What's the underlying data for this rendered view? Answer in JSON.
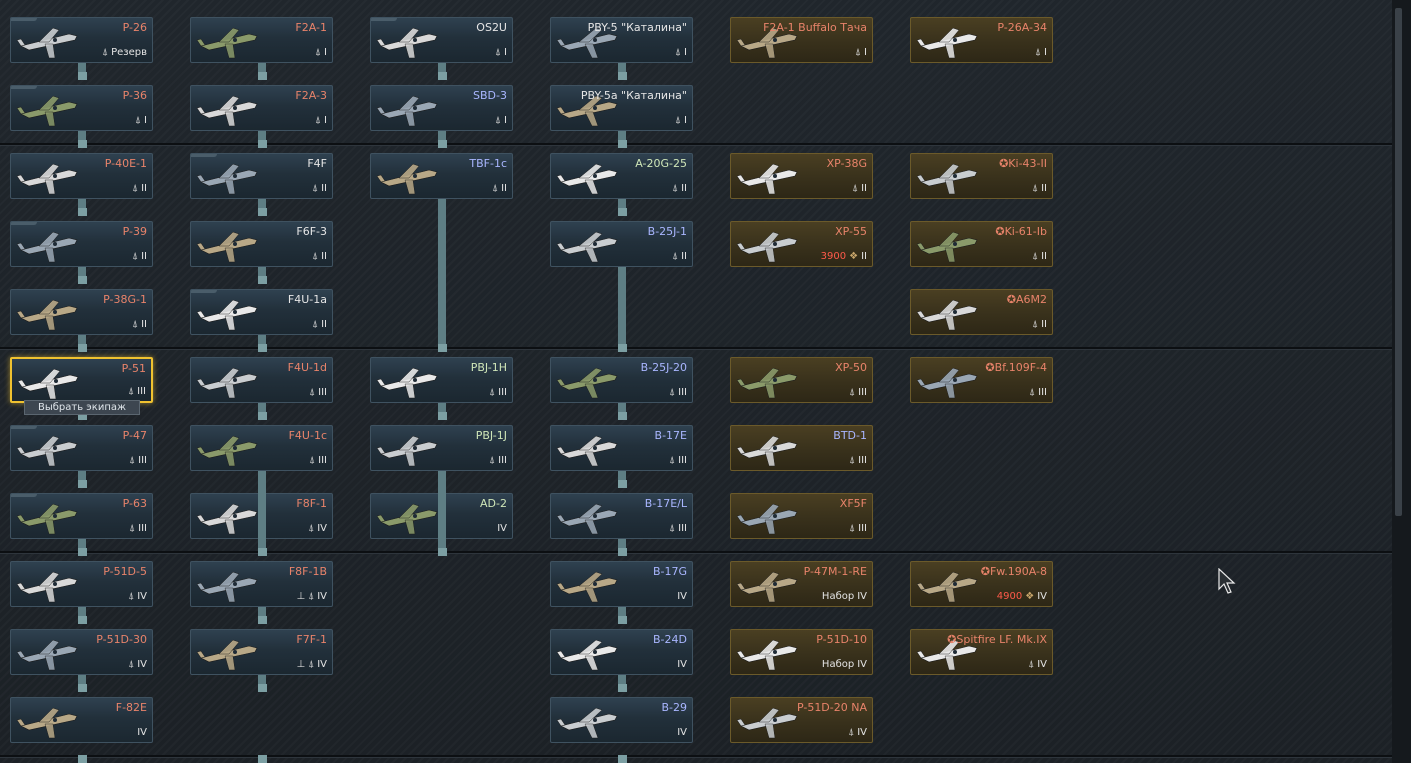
{
  "columns": [
    [
      {
        "name": "P-26",
        "sub": "Резерв",
        "rank": "",
        "color": "red",
        "tab": true
      },
      {
        "name": "P-36",
        "sub": "",
        "rank": "I",
        "color": "red",
        "tab": true
      },
      {
        "name": "P-40E-1",
        "sub": "",
        "rank": "II",
        "color": "red",
        "tab": false
      },
      {
        "name": "P-39",
        "sub": "",
        "rank": "II",
        "color": "red",
        "tab": true
      },
      {
        "name": "P-38G-1",
        "sub": "",
        "rank": "II",
        "color": "red",
        "tab": false
      },
      {
        "name": "P-51",
        "sub": "",
        "rank": "III",
        "color": "red",
        "tab": false,
        "selected": true
      },
      {
        "name": "P-47",
        "sub": "",
        "rank": "III",
        "color": "red",
        "tab": true
      },
      {
        "name": "P-63",
        "sub": "",
        "rank": "III",
        "color": "red",
        "tab": true
      },
      {
        "name": "P-51D-5",
        "sub": "",
        "rank": "IV",
        "color": "red",
        "tab": false
      },
      {
        "name": "P-51D-30",
        "sub": "",
        "rank": "IV",
        "color": "red",
        "tab": false
      },
      {
        "name": "F-82E",
        "sub": "",
        "rank": "IV",
        "color": "red",
        "tab": false,
        "nospade": true
      }
    ],
    [
      {
        "name": "F2A-1",
        "sub": "",
        "rank": "I",
        "color": "red",
        "tab": false
      },
      {
        "name": "F2A-3",
        "sub": "",
        "rank": "I",
        "color": "red",
        "tab": false
      },
      {
        "name": "F4F",
        "sub": "",
        "rank": "II",
        "color": "light",
        "tab": true
      },
      {
        "name": "F6F-3",
        "sub": "",
        "rank": "II",
        "color": "light",
        "tab": false
      },
      {
        "name": "F4U-1a",
        "sub": "",
        "rank": "II",
        "color": "light",
        "tab": true
      },
      {
        "name": "F4U-1d",
        "sub": "",
        "rank": "III",
        "color": "red",
        "tab": false
      },
      {
        "name": "F4U-1c",
        "sub": "",
        "rank": "III",
        "color": "red",
        "tab": false
      },
      {
        "name": "F8F-1",
        "sub": "",
        "rank": "IV",
        "color": "red",
        "tab": false
      },
      {
        "name": "F8F-1B",
        "sub": "",
        "rank": "IV",
        "color": "red",
        "tab": false,
        "bomb": true
      },
      {
        "name": "F7F-1",
        "sub": "",
        "rank": "IV",
        "color": "red",
        "tab": false,
        "bomb": true
      }
    ],
    [
      {
        "name": "OS2U",
        "sub": "",
        "rank": "I",
        "color": "light",
        "tab": true
      },
      {
        "name": "SBD-3",
        "sub": "",
        "rank": "I",
        "color": "blue",
        "tab": false
      },
      {
        "name": "TBF-1c",
        "sub": "",
        "rank": "II",
        "color": "blue",
        "tab": false
      },
      {
        "name": "PBJ-1H",
        "sub": "",
        "rank": "III",
        "color": "green",
        "tab": false
      },
      {
        "name": "PBJ-1J",
        "sub": "",
        "rank": "III",
        "color": "green",
        "tab": false
      },
      {
        "name": "AD-2",
        "sub": "",
        "rank": "IV",
        "color": "green",
        "tab": false,
        "nospade": true
      }
    ],
    [
      {
        "name": "PBY-5 \"Каталина\"",
        "sub": "",
        "rank": "I",
        "color": "light",
        "tab": false
      },
      {
        "name": "PBY-5a \"Каталина\"",
        "sub": "",
        "rank": "I",
        "color": "light",
        "tab": false
      },
      {
        "name": "A-20G-25",
        "sub": "",
        "rank": "II",
        "color": "green",
        "tab": false
      },
      {
        "name": "B-25J-1",
        "sub": "",
        "rank": "II",
        "color": "blue",
        "tab": false
      },
      {
        "name": "B-25J-20",
        "sub": "",
        "rank": "III",
        "color": "blue",
        "tab": false
      },
      {
        "name": "B-17E",
        "sub": "",
        "rank": "III",
        "color": "blue",
        "tab": false
      },
      {
        "name": "B-17E/L",
        "sub": "",
        "rank": "III",
        "color": "blue",
        "tab": false
      },
      {
        "name": "B-17G",
        "sub": "",
        "rank": "IV",
        "color": "blue",
        "tab": false,
        "nospade": true
      },
      {
        "name": "B-24D",
        "sub": "",
        "rank": "IV",
        "color": "blue",
        "tab": false,
        "nospade": true
      },
      {
        "name": "B-29",
        "sub": "",
        "rank": "IV",
        "color": "blue",
        "tab": false,
        "nospade": true
      }
    ],
    [
      {
        "name": "F2A-1 Buffalo Тача",
        "sub": "",
        "rank": "I",
        "color": "red"
      },
      {
        "name": "XP-38G",
        "sub": "",
        "rank": "II",
        "color": "red"
      },
      {
        "name": "XP-55",
        "price": "3900",
        "rank": "II",
        "color": "red"
      },
      {
        "name": "XP-50",
        "sub": "",
        "rank": "III",
        "color": "red"
      },
      {
        "name": "BTD-1",
        "sub": "",
        "rank": "III",
        "color": "blue"
      },
      {
        "name": "XF5F",
        "sub": "",
        "rank": "III",
        "color": "red"
      },
      {
        "name": "P-47M-1-RE",
        "sub": "Набор",
        "rank": "IV",
        "color": "red",
        "nospade": true
      },
      {
        "name": "P-51D-10",
        "sub": "Набор",
        "rank": "IV",
        "color": "red",
        "nospade": true
      },
      {
        "name": "P-51D-20 NA",
        "sub": "",
        "rank": "IV",
        "color": "red"
      }
    ],
    [
      {
        "name": "P-26A-34",
        "sub": "",
        "rank": "I",
        "color": "red"
      },
      {
        "name": "Ki-43-II",
        "sub": "",
        "rank": "II",
        "color": "red",
        "star": true
      },
      {
        "name": "Ki-61-Ib",
        "sub": "",
        "rank": "II",
        "color": "red",
        "star": true
      },
      {
        "name": "A6M2",
        "sub": "",
        "rank": "II",
        "color": "red",
        "star": true
      },
      {
        "name": "Bf.109F-4",
        "sub": "",
        "rank": "III",
        "color": "red",
        "star": true
      },
      {
        "name": "Fw.190A-8",
        "price": "4900",
        "rank": "IV",
        "color": "red",
        "star": true
      },
      {
        "name": "Spitfire LF. Mk.IX",
        "sub": "",
        "rank": "IV",
        "color": "red",
        "star": true
      }
    ]
  ],
  "tooltip": "Выбрать экипаж",
  "colors": {
    "red": "#e8836a",
    "blue": "#a9b6ff",
    "green": "#cfe6b8",
    "light": "#e6e6e6",
    "price": "#ff5a4a",
    "selected": "#f0c230"
  },
  "icons": {
    "spade": "spade-icon",
    "bomb": "bomb-icon",
    "star": "roundel-icon",
    "price": "warbond-icon"
  }
}
